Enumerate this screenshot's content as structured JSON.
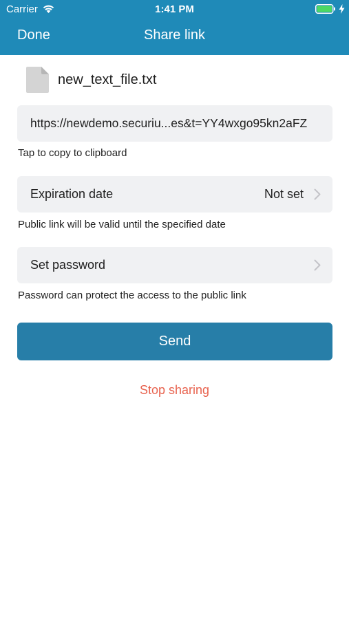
{
  "status_bar": {
    "carrier": "Carrier",
    "time": "1:41 PM",
    "wifi_icon": "wifi-icon",
    "battery_icon": "battery-icon",
    "charging_icon": "bolt-icon",
    "battery_color": "#4cd964"
  },
  "nav": {
    "done_label": "Done",
    "title": "Share link",
    "background_color": "#1f8ab8"
  },
  "file": {
    "icon": "file-icon",
    "name": "new_text_file.txt"
  },
  "link": {
    "url_display": "https://newdemo.securiu...es&t=YY4wxgo95kn2aFZ",
    "hint": "Tap to copy to clipboard"
  },
  "expiration": {
    "label": "Expiration date",
    "value": "Not set",
    "hint": "Public link will be valid until the specified date"
  },
  "password": {
    "label": "Set password",
    "hint": "Password can protect the access to the public link"
  },
  "actions": {
    "send_label": "Send",
    "send_color": "#277ea8",
    "stop_label": "Stop sharing",
    "stop_color": "#e8634f"
  }
}
